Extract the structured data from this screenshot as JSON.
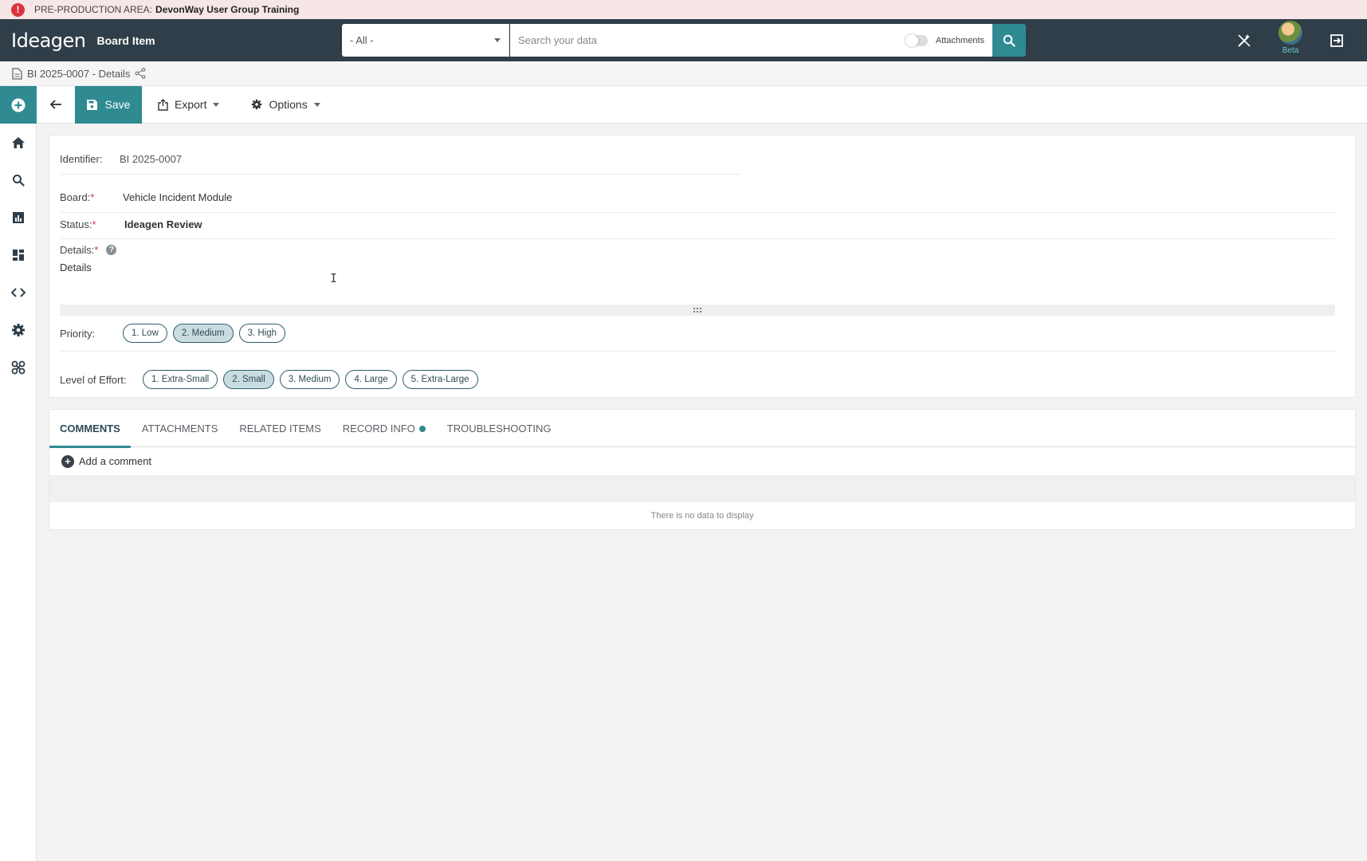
{
  "banner": {
    "prefix": "PRE-PRODUCTION AREA:",
    "area_name": "DevonWay User Group Training"
  },
  "header": {
    "logo_text": "Ideagen",
    "app_title": "Board Item",
    "scope_select": "- All -",
    "search_placeholder": "Search your data",
    "attachments_toggle_label": "Attachments",
    "beta_label": "Beta"
  },
  "breadcrumb": {
    "title": "BI 2025-0007 - Details"
  },
  "toolbar": {
    "save_label": "Save",
    "export_label": "Export",
    "options_label": "Options"
  },
  "form": {
    "identifier_label": "Identifier:",
    "identifier_value": "BI 2025-0007",
    "board_label": "Board:",
    "board_value": "Vehicle Incident Module",
    "status_label": "Status:",
    "status_value": "Ideagen Review",
    "details_label": "Details:",
    "details_value": "Details",
    "required_marker": "*",
    "priority_label": "Priority:",
    "priority_options": [
      "1. Low",
      "2. Medium",
      "3. High"
    ],
    "priority_selected": "2. Medium",
    "effort_label": "Level of Effort:",
    "effort_options": [
      "1. Extra-Small",
      "2. Small",
      "3. Medium",
      "4. Large",
      "5. Extra-Large"
    ],
    "effort_selected": "2. Small"
  },
  "tabs": {
    "items": [
      "COMMENTS",
      "ATTACHMENTS",
      "RELATED ITEMS",
      "RECORD INFO",
      "TROUBLESHOOTING"
    ],
    "active": "COMMENTS",
    "add_comment_label": "Add a comment",
    "empty_message": "There is no data to display"
  },
  "colors": {
    "accent": "#2f8a92",
    "header_bg": "#2f3e48",
    "banner_bg": "#f7e6e6",
    "required": "#d9363e"
  }
}
